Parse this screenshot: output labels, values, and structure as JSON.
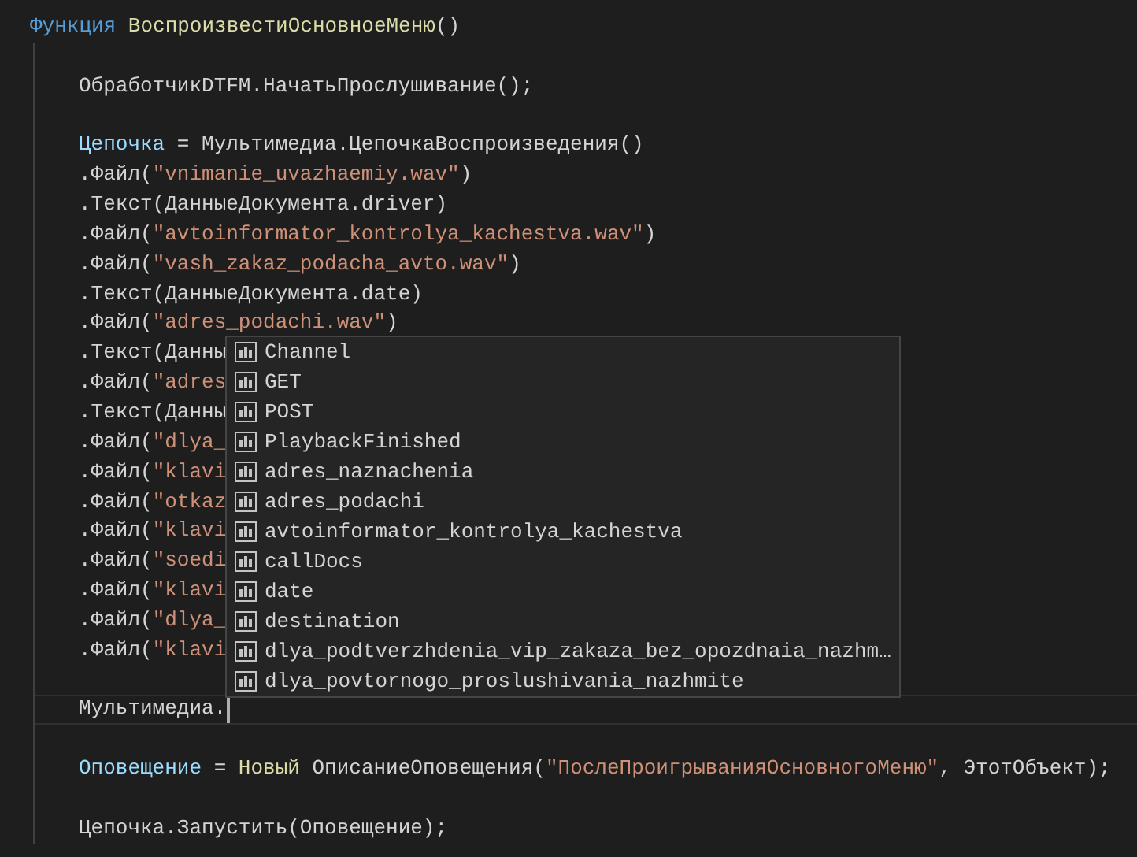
{
  "editor": {
    "lines": [
      {
        "kind": "code",
        "tokens": [
          {
            "kind": "keyword",
            "text": "Функция"
          },
          {
            "kind": "function",
            "text": "ВоспроизвестиОсновноеМеню"
          },
          {
            "kind": "plain",
            "text": "()"
          }
        ],
        "children": [
          {
            "kind": "blank"
          },
          {
            "kind": "code",
            "tokens": [
              {
                "kind": "plain",
                "text": "ОбработчикDTFM.НачатьПрослушивание();"
              }
            ]
          },
          {
            "kind": "blank"
          },
          {
            "kind": "code",
            "tokens": [
              {
                "kind": "variable",
                "text": "Цепочка"
              },
              {
                "kind": "plain",
                "text": " = Мультимедиа.ЦепочкаВоспроизведения()"
              }
            ]
          },
          {
            "kind": "code",
            "tokens": [
              {
                "kind": "plain",
                "text": ".Файл("
              },
              {
                "kind": "string",
                "text": "\"vnimanie_uvazhaemiy.wav\""
              },
              {
                "kind": "plain",
                "text": ")"
              }
            ]
          },
          {
            "kind": "code",
            "tokens": [
              {
                "kind": "plain",
                "text": ".Текст(ДанныеДокумента.driver)"
              }
            ]
          },
          {
            "kind": "code",
            "tokens": [
              {
                "kind": "plain",
                "text": ".Файл("
              },
              {
                "kind": "string",
                "text": "\"avtoinformator_kontrolya_kachestva.wav\""
              },
              {
                "kind": "plain",
                "text": ")"
              }
            ]
          },
          {
            "kind": "code",
            "tokens": [
              {
                "kind": "plain",
                "text": ".Файл("
              },
              {
                "kind": "string",
                "text": "\"vash_zakaz_podacha_avto.wav\""
              },
              {
                "kind": "plain",
                "text": ")"
              }
            ]
          },
          {
            "kind": "code",
            "tokens": [
              {
                "kind": "plain",
                "text": ".Текст(ДанныеДокумента.date)"
              }
            ]
          },
          {
            "kind": "code",
            "tokens": [
              {
                "kind": "plain",
                "text": ".Файл("
              },
              {
                "kind": "string",
                "text": "\"adres_podachi.wav\""
              },
              {
                "kind": "plain",
                "text": ")"
              }
            ]
          },
          {
            "kind": "code",
            "tokens": [
              {
                "kind": "plain",
                "text": ".Текст(Данны"
              }
            ]
          },
          {
            "kind": "code",
            "tokens": [
              {
                "kind": "plain",
                "text": ".Файл("
              },
              {
                "kind": "string",
                "text": "\"adres"
              }
            ]
          },
          {
            "kind": "code",
            "tokens": [
              {
                "kind": "plain",
                "text": ".Текст(Данны"
              }
            ]
          },
          {
            "kind": "code",
            "tokens": [
              {
                "kind": "plain",
                "text": ".Файл("
              },
              {
                "kind": "string",
                "text": "\"dlya_"
              }
            ]
          },
          {
            "kind": "code",
            "tokens": [
              {
                "kind": "plain",
                "text": ".Файл("
              },
              {
                "kind": "string",
                "text": "\"klavi"
              }
            ]
          },
          {
            "kind": "code",
            "tokens": [
              {
                "kind": "plain",
                "text": ".Файл("
              },
              {
                "kind": "string",
                "text": "\"otkaz"
              }
            ]
          },
          {
            "kind": "code",
            "tokens": [
              {
                "kind": "plain",
                "text": ".Файл("
              },
              {
                "kind": "string",
                "text": "\"klavi"
              }
            ]
          },
          {
            "kind": "code",
            "tokens": [
              {
                "kind": "plain",
                "text": ".Файл("
              },
              {
                "kind": "string",
                "text": "\"soedi"
              }
            ]
          },
          {
            "kind": "code",
            "tokens": [
              {
                "kind": "plain",
                "text": ".Файл("
              },
              {
                "kind": "string",
                "text": "\"klavi"
              }
            ]
          },
          {
            "kind": "code",
            "tokens": [
              {
                "kind": "plain",
                "text": ".Файл("
              },
              {
                "kind": "string",
                "text": "\"dlya_"
              }
            ]
          },
          {
            "kind": "code",
            "tokens": [
              {
                "kind": "plain",
                "text": ".Файл("
              },
              {
                "kind": "string",
                "text": "\"klavi"
              }
            ]
          },
          {
            "kind": "blank"
          },
          {
            "kind": "code",
            "current": true,
            "tokens": [
              {
                "kind": "plain",
                "text": "Мультимедиа."
              }
            ]
          },
          {
            "kind": "blank"
          },
          {
            "kind": "code",
            "tokens": [
              {
                "kind": "variable",
                "text": "Оповещение"
              },
              {
                "kind": "plain",
                "text": " = "
              },
              {
                "kind": "function",
                "text": "Новый"
              },
              {
                "kind": "plain",
                "text": " ОписаниеОповещения("
              },
              {
                "kind": "string",
                "text": "\"ПослеПроигрыванияОсновногоМеню\""
              },
              {
                "kind": "plain",
                "text": ", ЭтотОбъект);"
              }
            ]
          },
          {
            "kind": "blank"
          },
          {
            "kind": "code",
            "tokens": [
              {
                "kind": "plain",
                "text": "Цепочка.Запустить(Оповещение);"
              }
            ]
          }
        ]
      }
    ]
  },
  "suggestions": [
    {
      "label": "Channel",
      "selected": false
    },
    {
      "label": "GET",
      "selected": false
    },
    {
      "label": "POST",
      "selected": false
    },
    {
      "label": "PlaybackFinished",
      "selected": false
    },
    {
      "label": "adres_naznachenia",
      "selected": false
    },
    {
      "label": "adres_podachi",
      "selected": false
    },
    {
      "label": "avtoinformator_kontrolya_kachestva",
      "selected": false
    },
    {
      "label": "callDocs",
      "selected": false
    },
    {
      "label": "date",
      "selected": false
    },
    {
      "label": "destination",
      "selected": false
    },
    {
      "label": "dlya_podtverzhdenia_vip_zakaza_bez_opozdnaia_nazhm…",
      "selected": false
    },
    {
      "label": "dlya_povtornogo_proslushivania_nazhmite",
      "selected": false
    }
  ]
}
